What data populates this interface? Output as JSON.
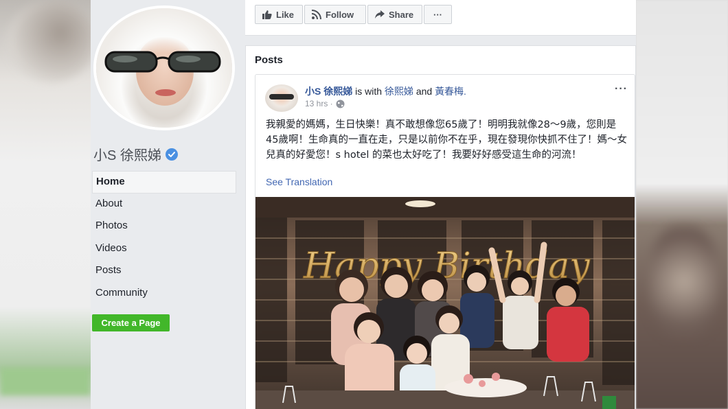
{
  "sidebar": {
    "page_name": "小S 徐熙娣",
    "nav": [
      "Home",
      "About",
      "Photos",
      "Videos",
      "Posts",
      "Community"
    ],
    "create_page": "Create a Page"
  },
  "actions": {
    "like": "Like",
    "follow": "Follow",
    "share": "Share",
    "more": "···"
  },
  "posts_section": {
    "title": "Posts"
  },
  "post": {
    "author": "小S 徐熙娣",
    "with_text": "is with",
    "tagged_1": "徐熙娣",
    "and_text": "and",
    "tagged_2": "黃春梅.",
    "time": "13 hrs ·",
    "more": "···",
    "text": "我親愛的媽媽，生日快樂！真不敢想像您65歲了！明明我就像28～9歲，您則是45歲啊！生命真的一直在走，只是以前你不在乎，現在發現你快抓不住了！媽～女兒真的好愛您！s hotel 的菜也太好吃了！我要好好感受這生命的河流！",
    "see_translation": "See Translation",
    "balloon_text": "Happy Birthday"
  },
  "colors": {
    "link": "#365899",
    "green_button": "#42b72a",
    "background": "#e9ebee"
  }
}
